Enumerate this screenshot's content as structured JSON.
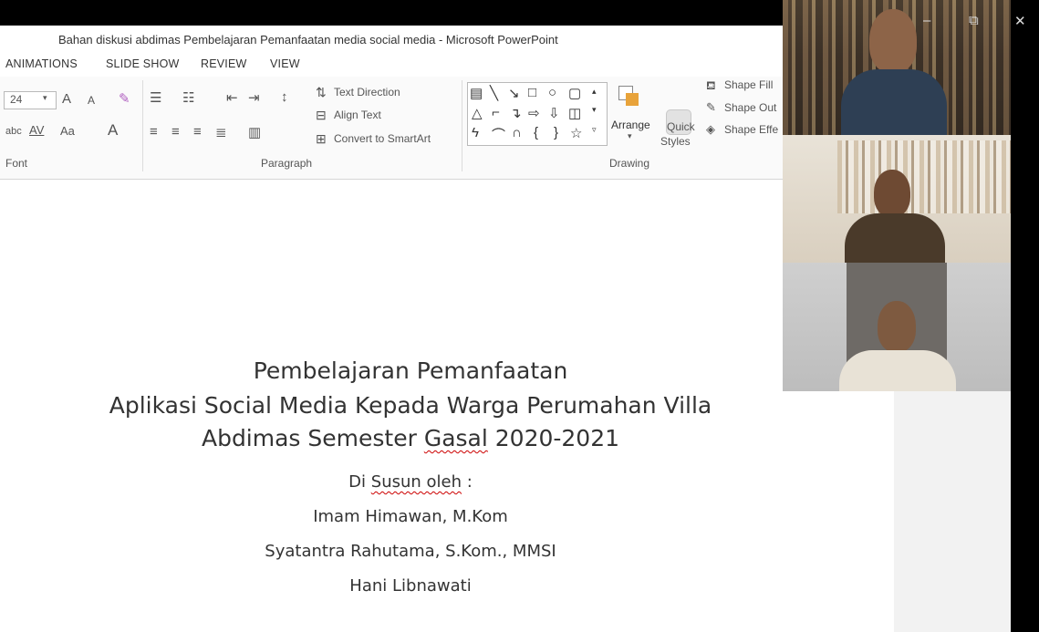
{
  "window": {
    "title": "Bahan diskusi abdimas Pembelajaran Pemanfaatan media social media - Microsoft PowerPoint",
    "controls": {
      "minimize": "–",
      "restore": "⧉",
      "close": "✕"
    }
  },
  "menu": [
    "ANIMATIONS",
    "SLIDE SHOW",
    "REVIEW",
    "VIEW"
  ],
  "ribbon": {
    "font": {
      "size": "24",
      "grow": "A",
      "shrink": "A",
      "spacing": "AV",
      "case": "Aa",
      "color": "A",
      "strike": "abc",
      "group_label": "Font"
    },
    "paragraph": {
      "text_direction": "Text Direction",
      "align_text": "Align Text",
      "convert_smartart": "Convert to SmartArt",
      "group_label": "Paragraph"
    },
    "drawing": {
      "arrange": "Arrange",
      "quick": "Quick",
      "styles": "Styles",
      "shape_fill": "Shape Fill",
      "shape_outline": "Shape Out",
      "shape_effects": "Shape Effe",
      "group_label": "Drawing"
    }
  },
  "slide": {
    "title_line1": "Pembelajaran Pemanfaatan",
    "title_line2": "Aplikasi Social Media Kepada Warga Perumahan Villa",
    "title_line3_a": "Abdimas Semester ",
    "title_line3_b": "Gasal",
    "title_line3_c": " 2020-2021",
    "subtitle_a": "Di ",
    "subtitle_b": "Susun oleh",
    "subtitle_c": " :",
    "author1": "Imam Himawan, M.Kom",
    "author2": "Syatantra Rahutama, S.Kom., MMSI",
    "author3": "Hani Libnawati"
  },
  "colors": {
    "ribbon_bg": "#fafafa",
    "accent": "#b7472a",
    "dark": "#000000"
  }
}
